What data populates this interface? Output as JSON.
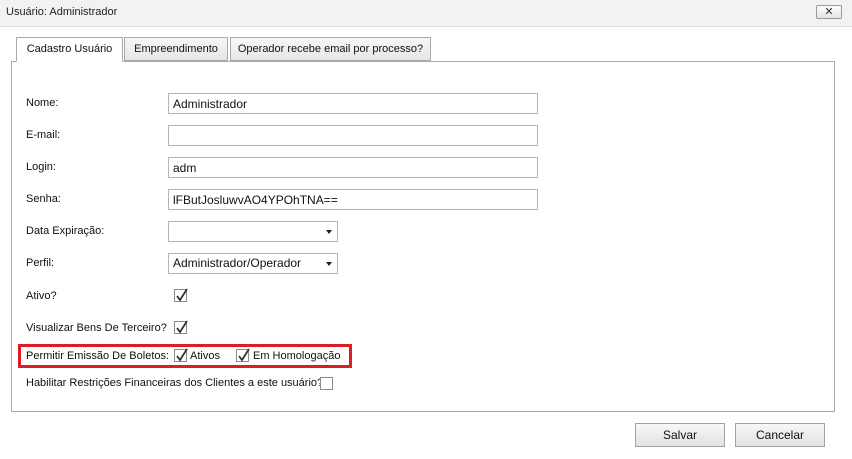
{
  "window": {
    "title": "Usuário: Administrador",
    "close_label": "✕"
  },
  "tabs": [
    {
      "label": "Cadastro Usuário",
      "active": true
    },
    {
      "label": "Empreendimento",
      "active": false
    },
    {
      "label": "Operador recebe email por processo?",
      "active": false
    }
  ],
  "form": {
    "nome": {
      "label": "Nome:",
      "value": "Administrador"
    },
    "email": {
      "label": "E-mail:",
      "value": ""
    },
    "login": {
      "label": "Login:",
      "value": "adm"
    },
    "senha": {
      "label": "Senha:",
      "value": "lFButJosluwvAO4YPOhTNA=="
    },
    "data_expiracao": {
      "label": "Data Expiração:",
      "value": ""
    },
    "perfil": {
      "label": "Perfil:",
      "value": "Administrador/Operador"
    },
    "ativo": {
      "label": "Ativo?",
      "checked": true
    },
    "visualizar_bens": {
      "label": "Visualizar Bens De Terceiro?",
      "checked": true
    },
    "permitir_boletos": {
      "label": "Permitir Emissão De Boletos:",
      "ativos": {
        "label": "Ativos",
        "checked": true
      },
      "homologacao": {
        "label": "Em Homologação",
        "checked": true
      }
    },
    "restricoes": {
      "label": "Habilitar Restrições Financeiras dos Clientes a este usuário?",
      "checked": false
    }
  },
  "buttons": {
    "save": "Salvar",
    "cancel": "Cancelar"
  },
  "colors": {
    "highlight": "#e11b22"
  }
}
